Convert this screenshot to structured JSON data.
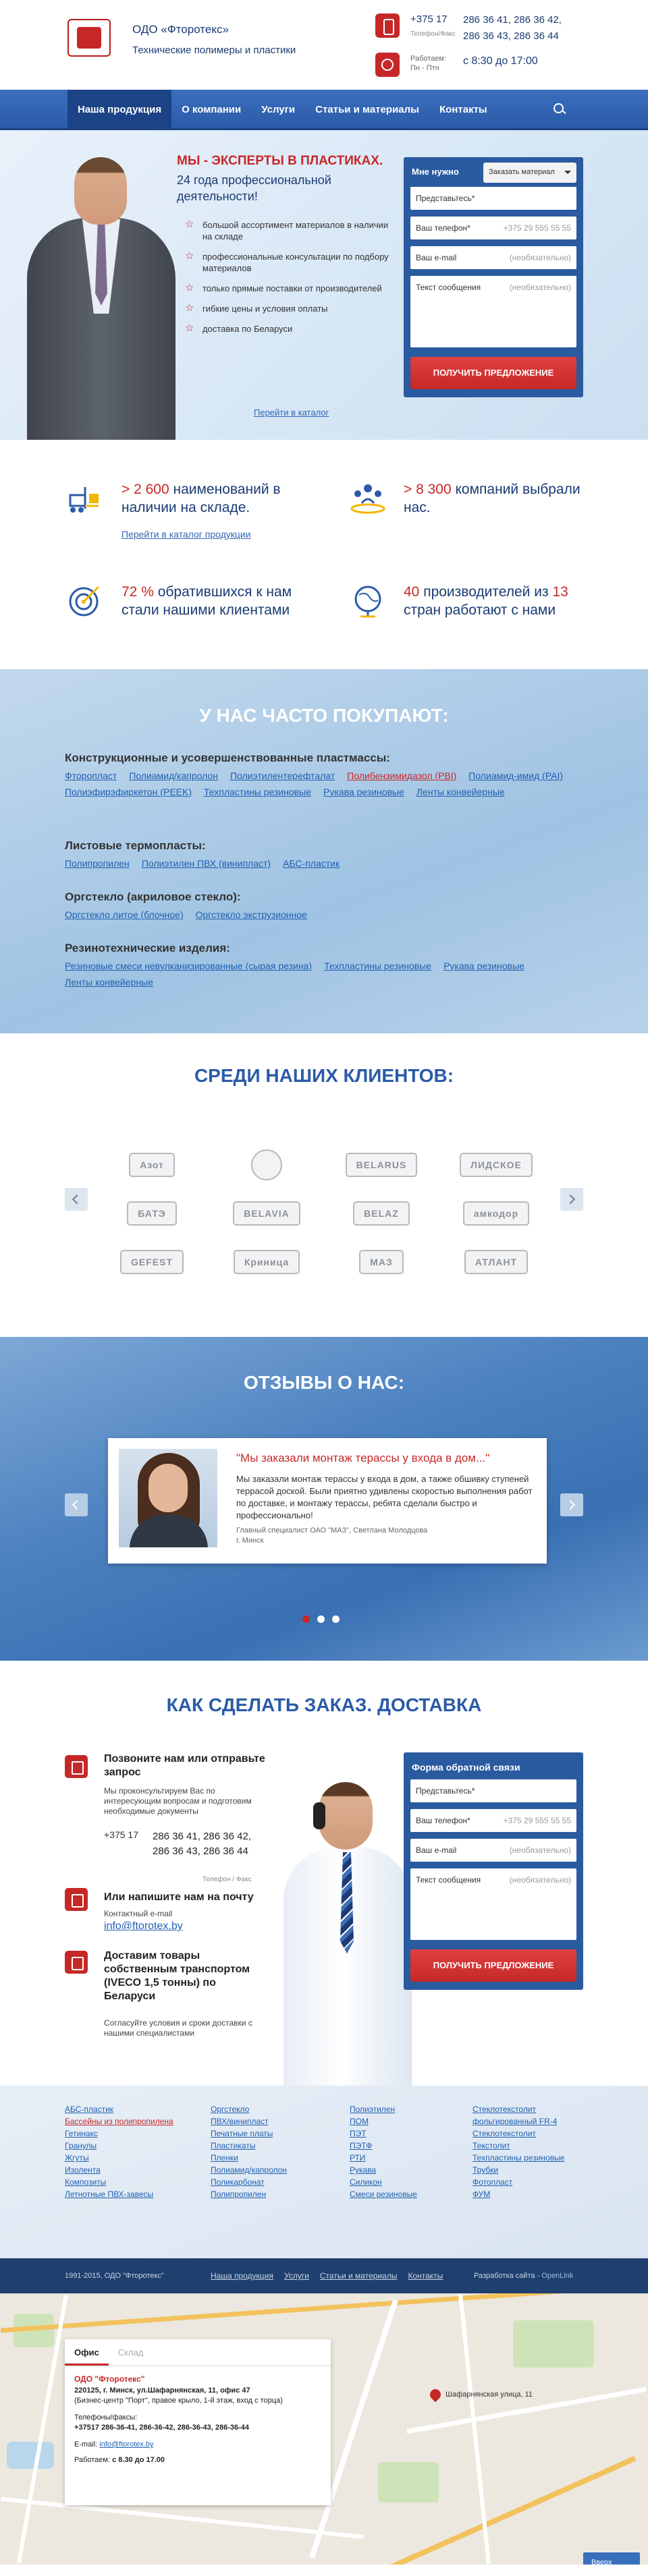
{
  "header": {
    "company": "ОДО «Фторотекс»",
    "tagline": "Технические полимеры и пластики",
    "phone_code": "+375 17",
    "phone_label": "Телефон/Факс",
    "phones": [
      "286 36 41, 286 36 42,",
      "286 36 43, 286 36 44"
    ],
    "work_label": "Работаем: Пн - Птн",
    "work_hours": "с 8:30 до 17:00"
  },
  "nav": {
    "items": [
      "Наша продукция",
      "О компании",
      "Услуги",
      "Статьи и материалы",
      "Контакты"
    ]
  },
  "hero": {
    "title": "МЫ - ЭКСПЕРТЫ В ПЛАСТИКАХ.",
    "subtitle": "24 года профессиональной деятельности!",
    "bullets": [
      "большой ассортимент материалов в наличии на складе",
      "профессиональные консультации по подбору материалов",
      "только прямые поставки от производителей",
      "гибкие цены и условия оплаты",
      "доставка по Беларуси"
    ],
    "catalog_link": "Перейти в каталог"
  },
  "hero_form": {
    "need_label": "Мне нужно",
    "select_value": "Заказать материал",
    "name_placeholder": "Представьтесь*",
    "phone_placeholder": "Ваш телефон*",
    "phone_hint": "+375 29 555 55 55",
    "email_placeholder": "Ваш e-mail",
    "email_hint": "(необязательно)",
    "message_placeholder": "Текст сообщения",
    "message_hint": "(необязательно)",
    "submit": "ПОЛУЧИТЬ ПРЕДЛОЖЕНИЕ"
  },
  "stats": {
    "s1_num": "> 2 600",
    "s1_text": " наименований в наличии на складе.",
    "s1_link": "Перейти в каталог продукции",
    "s2_num": "> 8 300",
    "s2_text": " компаний выбрали нас.",
    "s3_num": "72 %",
    "s3_text": " обратившихся к нам стали нашими клиентами",
    "s4_num1": "40",
    "s4_text1": " производителей из ",
    "s4_num2": "13",
    "s4_text2": " стран работают с нами"
  },
  "often": {
    "title": "У НАС ЧАСТО ПОКУПАЮТ:",
    "groups": [
      {
        "title": "Конструкционные и усовершенствованные пластмассы:",
        "links": [
          "Фторопласт",
          "Полиамид/капролон",
          "Полиэтилентерефталат",
          "Полибензимидазол (PBI)",
          "Полиамид-имид (PAI)",
          "Полиэфирэфиркетон (PEEK)",
          "Техпластины резиновые",
          "Рукава резиновые",
          "Ленты конвейерные"
        ]
      },
      {
        "title": "Листовые термопласты:",
        "links": [
          "Полипропилен",
          "Полиэтилен ПВХ (винипласт)",
          "АБС-пластик"
        ]
      },
      {
        "title": "Оргстекло (акриловое стекло):",
        "links": [
          "Оргстекло литое (блочное)",
          "Оргстекло экструзионное"
        ]
      },
      {
        "title": "Резинотехнические изделия:",
        "links": [
          "Резиновые смеси невулканизированные (сырая резина)",
          "Техпластины резиновые",
          "Рукава резиновые",
          "Ленты конвейерные"
        ]
      }
    ]
  },
  "clients": {
    "title": "СРЕДИ НАШИХ КЛИЕНТОВ:",
    "logos": [
      "Азот",
      "",
      "BELARUS",
      "ЛИДСКОЕ",
      "БАТЭ",
      "BELAVIA",
      "BELAZ",
      "амкодор",
      "GEFEST",
      "Криница",
      "МАЗ",
      "АТЛАНТ"
    ]
  },
  "reviews": {
    "title": "ОТЗЫВЫ О НАС:",
    "quote": "\"Мы заказали монтаж терассы у входа в дом...\"",
    "text": "Мы заказали монтаж терассы у входа в дом, а также обшивку ступеней террасой доской. Были приятно удивлены скоростью выполнения работ по доставке, и монтажу терассы, ребята сделали быстро и профессионально!",
    "author": "Главный специалист ОАО \"МАЗ\", Светлана Молодцова",
    "city": "г. Минск"
  },
  "order": {
    "title": "КАК СДЕЛАТЬ ЗАКАЗ. ДОСТАВКА",
    "call_title": "Позвоните нам или отправьте запрос",
    "call_text": "Мы проконсультируем Вас по интересующим вопросам и подготовим необходимые документы",
    "phone_code": "+375 17",
    "phones": [
      "286 36 41, 286 36 42,",
      "286 36 43, 286 36 44"
    ],
    "phones_label": "Телефон / Факс",
    "mail_title": "Или напишите нам на почту",
    "mail_label": "Контактный e-mail",
    "mail": "info@ftorotex.by",
    "delivery_title": "Доставим товары собственным транспортом (IVECO 1,5 тонны) по Беларуси",
    "delivery_text": "Согласуйте условия и сроки доставки с нашими специалистами",
    "form_title": "Форма обратной связи",
    "name_placeholder": "Представьтесь*",
    "phone_placeholder": "Ваш телефон*",
    "phone_hint": "+375 29 555 55 55",
    "email_placeholder": "Ваш e-mail",
    "email_hint": "(необязательно)",
    "message_placeholder": "Текст сообщения",
    "message_hint": "(необязательно)",
    "submit": "ПОЛУЧИТЬ ПРЕДЛОЖЕНИЕ"
  },
  "footer_links": {
    "col1": [
      "АБС-пластик",
      "Бассейны из полипропилена",
      "Гетинакс",
      "Гранулы",
      "Жгуты",
      "Изолента",
      "Композиты",
      "Летнотные ПВХ-завесы"
    ],
    "col2": [
      "Оргстекло",
      "ПВХ/винипласт",
      "Печатные платы",
      "Пластикаты",
      "Пленки",
      "Полиамид/капролон",
      "Поликарбонат",
      "Полипропилен"
    ],
    "col3": [
      "Полиэтилен",
      "ПОМ",
      "ПЭТ",
      "ПЭТФ",
      "РТИ",
      "Рукава",
      "Силикон",
      "Смеси резиновые"
    ],
    "col4": [
      "Стеклотекстолит",
      "фольгированный FR-4",
      "Стеклотекстолит",
      "Текстолит",
      "Техпластины резиновые",
      "Трубки",
      "Фотопласт",
      "ФУМ"
    ]
  },
  "bottombar": {
    "copyright": "1991-2015, ОДО \"Фторотекс\"",
    "links": [
      "Наша продукция",
      "Услуги",
      "Статьи и материалы",
      "Контакты"
    ],
    "dev_label": "Разработка сайта - ",
    "dev_name": "OpenLink"
  },
  "map": {
    "tab_office": "Офис",
    "tab_warehouse": "Склад",
    "org": "ОДО \"Фторотекс\"",
    "address": "220125, г. Минск, ул.Шафарнянская, 11, офис 47",
    "address_note": "(Бизнес-центр \"Порт\", правое крыло, 1-й этаж, вход с торца)",
    "phones_label": "Телефоны/факсы:",
    "phones": "+37517 286-36-41, 286-36-42, 286-36-43, 286-36-44",
    "email_label": "E-mail: ",
    "email": "info@ftorotex.by",
    "hours_label": "Работаем: ",
    "hours": "с 8.30 до 17.00",
    "pin_label": "Шафарнянская улица, 11",
    "up_button": "Вверх"
  }
}
